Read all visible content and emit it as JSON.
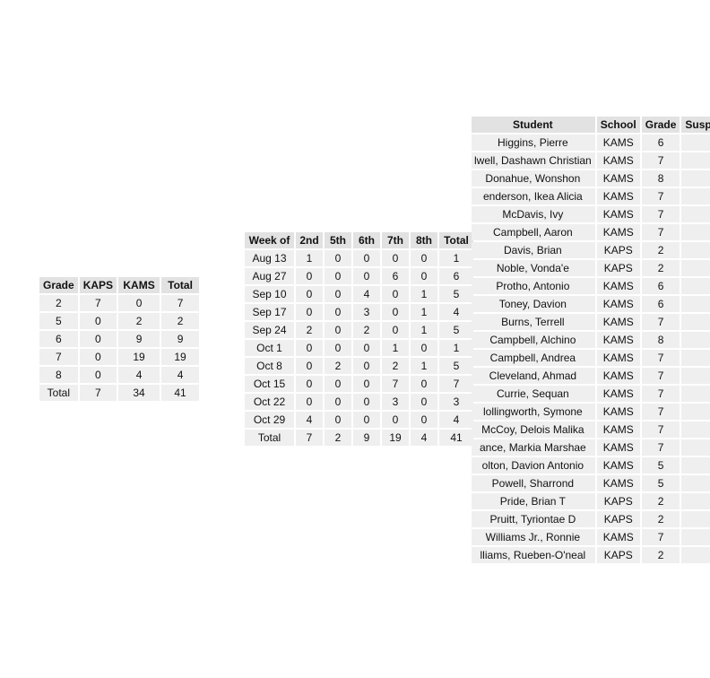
{
  "grade_table": {
    "headers": [
      "Grade",
      "KAPS",
      "KAMS",
      "Total"
    ],
    "rows": [
      [
        "2",
        "7",
        "0",
        "7"
      ],
      [
        "5",
        "0",
        "2",
        "2"
      ],
      [
        "6",
        "0",
        "9",
        "9"
      ],
      [
        "7",
        "0",
        "19",
        "19"
      ],
      [
        "8",
        "0",
        "4",
        "4"
      ],
      [
        "Total",
        "7",
        "34",
        "41"
      ]
    ]
  },
  "week_table": {
    "headers": [
      "Week of",
      "2nd",
      "5th",
      "6th",
      "7th",
      "8th",
      "Total"
    ],
    "rows": [
      [
        "Aug 13",
        "1",
        "0",
        "0",
        "0",
        "0",
        "1"
      ],
      [
        "Aug 27",
        "0",
        "0",
        "0",
        "6",
        "0",
        "6"
      ],
      [
        "Sep 10",
        "0",
        "0",
        "4",
        "0",
        "1",
        "5"
      ],
      [
        "Sep 17",
        "0",
        "0",
        "3",
        "0",
        "1",
        "4"
      ],
      [
        "Sep 24",
        "2",
        "0",
        "2",
        "0",
        "1",
        "5"
      ],
      [
        "Oct 1",
        "0",
        "0",
        "0",
        "1",
        "0",
        "1"
      ],
      [
        "Oct 8",
        "0",
        "2",
        "0",
        "2",
        "1",
        "5"
      ],
      [
        "Oct 15",
        "0",
        "0",
        "0",
        "7",
        "0",
        "7"
      ],
      [
        "Oct 22",
        "0",
        "0",
        "0",
        "3",
        "0",
        "3"
      ],
      [
        "Oct 29",
        "4",
        "0",
        "0",
        "0",
        "0",
        "4"
      ],
      [
        "Total",
        "7",
        "2",
        "9",
        "19",
        "4",
        "41"
      ]
    ]
  },
  "student_table": {
    "headers": [
      "Student",
      "School",
      "Grade",
      "Susp"
    ],
    "rows": [
      [
        "Higgins, Pierre",
        "KAMS",
        "6",
        ""
      ],
      [
        "lwell, Dashawn Christian",
        "KAMS",
        "7",
        ""
      ],
      [
        "Donahue, Wonshon",
        "KAMS",
        "8",
        ""
      ],
      [
        "enderson, Ikea Alicia",
        "KAMS",
        "7",
        ""
      ],
      [
        "McDavis, Ivy",
        "KAMS",
        "7",
        ""
      ],
      [
        "Campbell, Aaron",
        "KAMS",
        "7",
        ""
      ],
      [
        "Davis, Brian",
        "KAPS",
        "2",
        ""
      ],
      [
        "Noble, Vonda'e",
        "KAPS",
        "2",
        ""
      ],
      [
        "Protho, Antonio",
        "KAMS",
        "6",
        ""
      ],
      [
        "Toney, Davion",
        "KAMS",
        "6",
        ""
      ],
      [
        "Burns, Terrell",
        "KAMS",
        "7",
        ""
      ],
      [
        "Campbell, Alchino",
        "KAMS",
        "8",
        ""
      ],
      [
        "Campbell, Andrea",
        "KAMS",
        "7",
        ""
      ],
      [
        "Cleveland, Ahmad",
        "KAMS",
        "7",
        ""
      ],
      [
        "Currie, Sequan",
        "KAMS",
        "7",
        ""
      ],
      [
        "lollingworth, Symone",
        "KAMS",
        "7",
        ""
      ],
      [
        "McCoy, Delois Malika",
        "KAMS",
        "7",
        ""
      ],
      [
        "ance, Markia Marshae",
        "KAMS",
        "7",
        ""
      ],
      [
        "olton, Davion Antonio",
        "KAMS",
        "5",
        ""
      ],
      [
        "Powell, Sharrond",
        "KAMS",
        "5",
        ""
      ],
      [
        "Pride, Brian T",
        "KAPS",
        "2",
        ""
      ],
      [
        "Pruitt, Tyriontae D",
        "KAPS",
        "2",
        ""
      ],
      [
        "Williams Jr., Ronnie",
        "KAMS",
        "7",
        ""
      ],
      [
        "lliams, Rueben-O'neal",
        "KAPS",
        "2",
        ""
      ]
    ]
  }
}
